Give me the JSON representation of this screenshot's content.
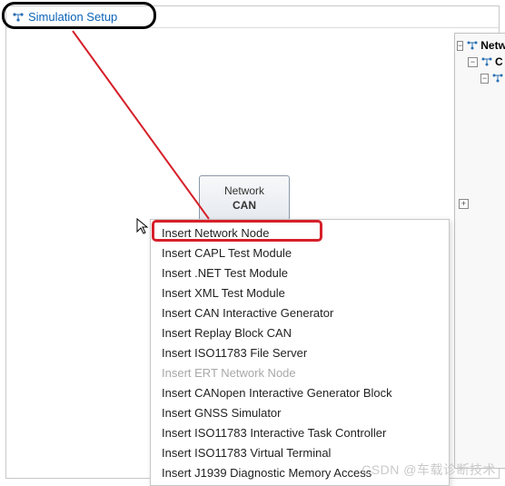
{
  "title": "Simulation Setup",
  "network_box": {
    "top": "Network",
    "bottom": "CAN"
  },
  "tree": {
    "root_label": "Netw",
    "child_label": "C",
    "toggle_minus": "−",
    "toggle_plus": "+"
  },
  "context_menu": {
    "items": [
      {
        "label": "Insert Network Node",
        "enabled": true,
        "highlighted": true
      },
      {
        "label": "Insert CAPL Test Module",
        "enabled": true
      },
      {
        "label": "Insert .NET Test Module",
        "enabled": true
      },
      {
        "label": "Insert XML Test Module",
        "enabled": true
      },
      {
        "label": "Insert CAN Interactive Generator",
        "enabled": true
      },
      {
        "label": "Insert Replay Block CAN",
        "enabled": true
      },
      {
        "label": "Insert ISO11783 File Server",
        "enabled": true
      },
      {
        "label": "Insert ERT Network Node",
        "enabled": false
      },
      {
        "label": "Insert CANopen Interactive Generator Block",
        "enabled": true
      },
      {
        "label": "Insert GNSS Simulator",
        "enabled": true
      },
      {
        "label": "Insert ISO11783 Interactive Task Controller",
        "enabled": true
      },
      {
        "label": "Insert ISO11783 Virtual Terminal",
        "enabled": true
      },
      {
        "label": "Insert J1939 Diagnostic Memory Access",
        "enabled": true
      }
    ]
  },
  "watermark": "CSDN @车载诊断技术"
}
